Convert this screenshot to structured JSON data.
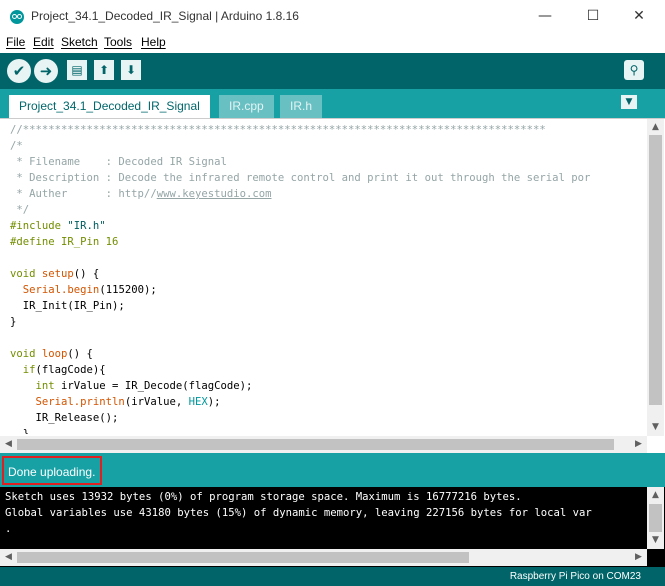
{
  "window": {
    "title": "Project_34.1_Decoded_IR_Signal | Arduino 1.8.16",
    "minimize": "—",
    "maximize": "☐",
    "close": "✕"
  },
  "menu": [
    "File",
    "Edit",
    "Sketch",
    "Tools",
    "Help"
  ],
  "toolbar": {
    "verify_icon": "✔",
    "upload_icon": "➜",
    "new_icon": "▤",
    "open_icon": "⬆",
    "save_icon": "⬇",
    "serial_icon": "⚲"
  },
  "tabs": [
    {
      "label": "Project_34.1_Decoded_IR_Signal",
      "active": true
    },
    {
      "label": "IR.cpp",
      "active": false
    },
    {
      "label": "IR.h",
      "active": false
    }
  ],
  "tab_menu_icon": "▼",
  "editor": {
    "lines": [
      "//**********************************************************************************",
      "/*",
      " * Filename    : Decoded IR Signal",
      " * Description : Decode the infrared remote control and print it out through the serial por",
      " * Auther      : http//www.keyestudio.com",
      " */",
      "#include \"IR.h\"",
      "#define IR_Pin 16",
      "",
      "void setup() {",
      "  Serial.begin(115200);",
      "  IR_Init(IR_Pin);",
      "}",
      "",
      "void loop() {",
      "  if(flagCode){",
      "    int irValue = IR_Decode(flagCode);",
      "    Serial.println(irValue, HEX);",
      "    IR_Release();",
      "  }"
    ]
  },
  "status": {
    "message": "Done uploading."
  },
  "console": {
    "lines": [
      "Sketch uses 13932 bytes (0%) of program storage space. Maximum is 16777216 bytes.",
      "Global variables use 43180 bytes (15%) of dynamic memory, leaving 227156 bytes for local var",
      "."
    ]
  },
  "footer": {
    "board": "Raspberry Pi Pico on COM23"
  },
  "colors": {
    "toolbar": "#006468",
    "tabbar": "#17a1a5",
    "status_highlight": "#e02020"
  }
}
